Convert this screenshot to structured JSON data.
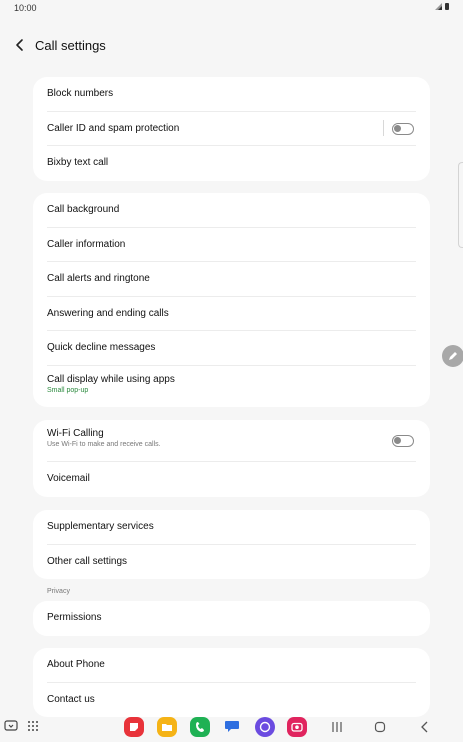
{
  "status": {
    "time": "10:00"
  },
  "header": {
    "title": "Call settings"
  },
  "card1": [
    {
      "label": "Block numbers"
    },
    {
      "label": "Caller ID and spam protection"
    },
    {
      "label": "Bixby text call"
    }
  ],
  "card2": [
    {
      "label": "Call background"
    },
    {
      "label": "Caller information"
    },
    {
      "label": "Call alerts and ringtone"
    },
    {
      "label": "Answering and ending calls"
    },
    {
      "label": "Quick decline messages"
    },
    {
      "label": "Call display while using apps",
      "sub": "Small pop-up"
    }
  ],
  "card3": [
    {
      "label": "Wi-Fi Calling",
      "sub": "Use Wi-Fi to make and receive calls."
    },
    {
      "label": "Voicemail"
    }
  ],
  "card4": [
    {
      "label": "Supplementary services"
    },
    {
      "label": "Other call settings"
    }
  ],
  "privacy": {
    "section_label": "Privacy",
    "items": [
      {
        "label": "Permissions"
      }
    ]
  },
  "card6": [
    {
      "label": "About Phone"
    },
    {
      "label": "Contact us"
    }
  ],
  "toggles": {
    "caller_id_spam": false,
    "wifi_calling": false
  },
  "colors": {
    "background": "#f6f6f6",
    "card": "#ffffff",
    "subtext_green": "#2b8a3e",
    "app_red": "#e8333a",
    "app_yellow": "#f5b316",
    "app_green": "#1fb154",
    "app_blue": "#2f6fe0",
    "app_purple": "#6b4be0",
    "app_pink": "#e0245e"
  },
  "taskbar": {
    "apps": [
      "recent-apps-icon",
      "all-apps-icon",
      "notes-app-icon",
      "my-files-app-icon",
      "phone-app-icon",
      "messages-app-icon",
      "internet-app-icon",
      "camera-app-icon"
    ],
    "nav": [
      "recents-button",
      "home-button",
      "back-button"
    ]
  }
}
